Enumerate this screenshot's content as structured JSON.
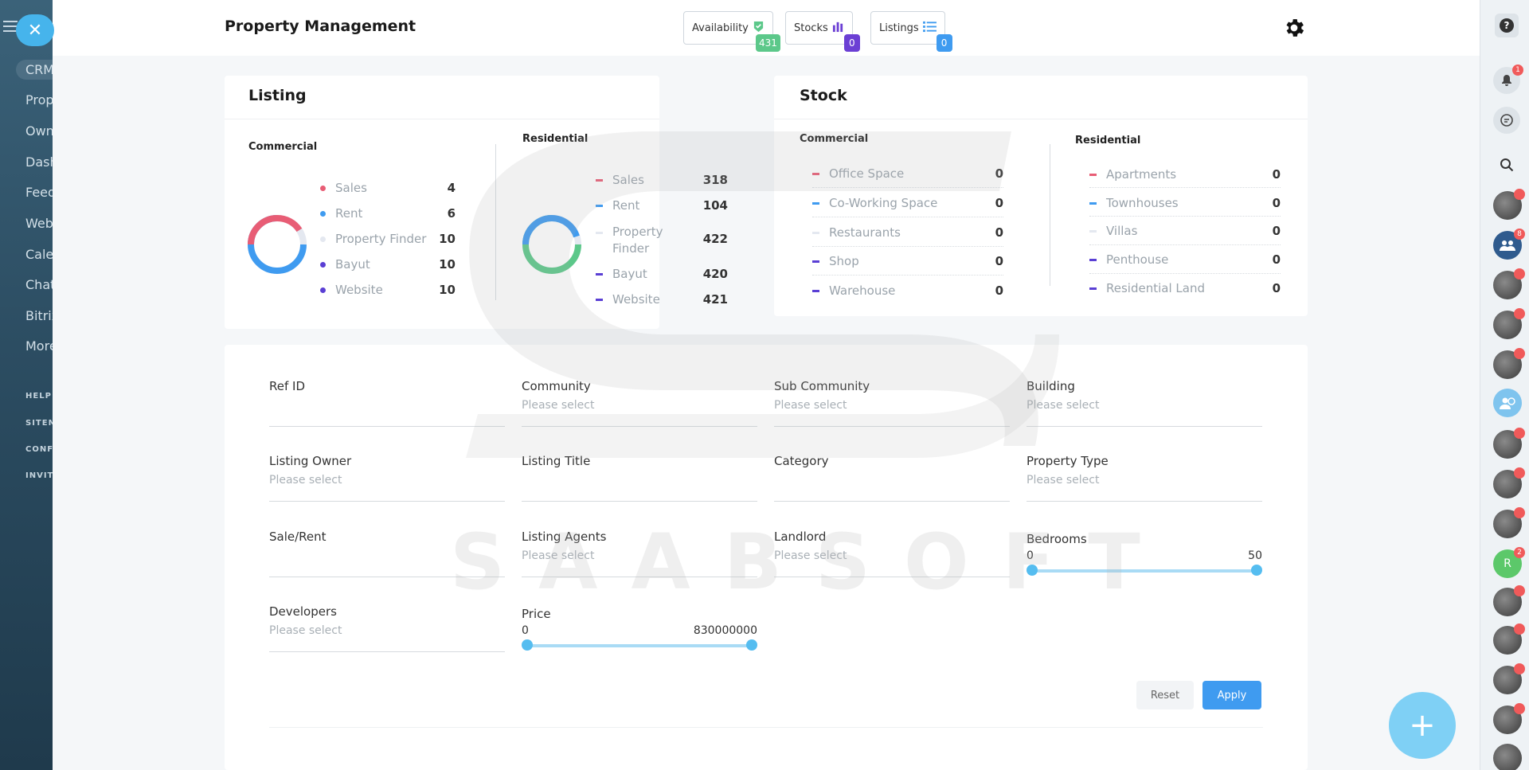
{
  "app": {
    "title": "Property Management"
  },
  "sidebar": {
    "items": [
      {
        "label": "CRM",
        "active": true
      },
      {
        "label": "Prop"
      },
      {
        "label": "Own"
      },
      {
        "label": "Dash"
      },
      {
        "label": "Feed"
      },
      {
        "label": "Web"
      },
      {
        "label": "Cale"
      },
      {
        "label": "Chat"
      },
      {
        "label": "Bitrix"
      },
      {
        "label": "More"
      }
    ],
    "small_items": [
      "HELP",
      "SITEM",
      "CONF",
      "INVIT"
    ]
  },
  "header_tabs": [
    {
      "label": "Availability",
      "icon": "check-badge-icon",
      "badge": "431",
      "badge_color": "#5cc88a"
    },
    {
      "label": "Stocks",
      "icon": "bar-chart-icon",
      "badge": "0",
      "badge_color": "#6b3fd4"
    },
    {
      "label": "Listings",
      "icon": "list-icon",
      "badge": "0",
      "badge_color": "#3f9bf0"
    }
  ],
  "listing": {
    "title": "Listing",
    "commercial": {
      "title": "Commercial",
      "items": [
        {
          "label": "Sales",
          "value": "4",
          "color": "#e85d75"
        },
        {
          "label": "Rent",
          "value": "6",
          "color": "#3f9bf0"
        },
        {
          "label": "Property Finder",
          "value": "10",
          "color": "#e4e8f0"
        },
        {
          "label": "Bayut",
          "value": "10",
          "color": "#5a3fd4"
        },
        {
          "label": "Website",
          "value": "10",
          "color": "#5a3fd4"
        }
      ]
    },
    "residential": {
      "title": "Residential",
      "items": [
        {
          "label": "Sales",
          "value": "318",
          "color": "#e85d75"
        },
        {
          "label": "Rent",
          "value": "104",
          "color": "#3f9bf0"
        },
        {
          "label": "Property Finder",
          "value": "422",
          "color": "#e4e8f0"
        },
        {
          "label": "Bayut",
          "value": "420",
          "color": "#5a3fd4"
        },
        {
          "label": "Website",
          "value": "421",
          "color": "#5a3fd4"
        }
      ]
    }
  },
  "stock": {
    "title": "Stock",
    "commercial": {
      "title": "Commercial",
      "items": [
        {
          "label": "Office Space",
          "value": "0",
          "color": "#e85d75"
        },
        {
          "label": "Co-Working Space",
          "value": "0",
          "color": "#3f9bf0"
        },
        {
          "label": "Restaurants",
          "value": "0",
          "color": "#e4e8f0"
        },
        {
          "label": "Shop",
          "value": "0",
          "color": "#5a3fd4"
        },
        {
          "label": "Warehouse",
          "value": "0",
          "color": "#5a3fd4"
        }
      ]
    },
    "residential": {
      "title": "Residential",
      "items": [
        {
          "label": "Apartments",
          "value": "0",
          "color": "#e85d75"
        },
        {
          "label": "Townhouses",
          "value": "0",
          "color": "#3f9bf0"
        },
        {
          "label": "Villas",
          "value": "0",
          "color": "#e4e8f0"
        },
        {
          "label": "Penthouse",
          "value": "0",
          "color": "#5a3fd4"
        },
        {
          "label": "Residential Land",
          "value": "0",
          "color": "#5a3fd4"
        }
      ]
    }
  },
  "filters": {
    "fields": [
      {
        "label": "Ref ID",
        "placeholder": ""
      },
      {
        "label": "Community",
        "placeholder": "Please select"
      },
      {
        "label": "Sub Community",
        "placeholder": "Please select"
      },
      {
        "label": "Building",
        "placeholder": "Please select"
      },
      {
        "label": "Listing Owner",
        "placeholder": "Please select"
      },
      {
        "label": "Listing Title",
        "placeholder": ""
      },
      {
        "label": "Category",
        "placeholder": ""
      },
      {
        "label": "Property Type",
        "placeholder": "Please select"
      },
      {
        "label": "Sale/Rent",
        "placeholder": ""
      },
      {
        "label": "Listing Agents",
        "placeholder": "Please select"
      },
      {
        "label": "Landlord",
        "placeholder": "Please select"
      },
      {
        "label": "Developers",
        "placeholder": "Please select"
      }
    ],
    "bedrooms": {
      "label": "Bedrooms",
      "min": "0",
      "max": "50"
    },
    "price": {
      "label": "Price",
      "min": "0",
      "max": "830000000"
    },
    "reset_label": "Reset",
    "apply_label": "Apply"
  },
  "watermark": {
    "text": "SAABSOFT"
  },
  "right_rail": {
    "notification_badge": "1",
    "group_badge": "8",
    "avatar_r_letter": "R",
    "avatar_r_badge": "2"
  }
}
